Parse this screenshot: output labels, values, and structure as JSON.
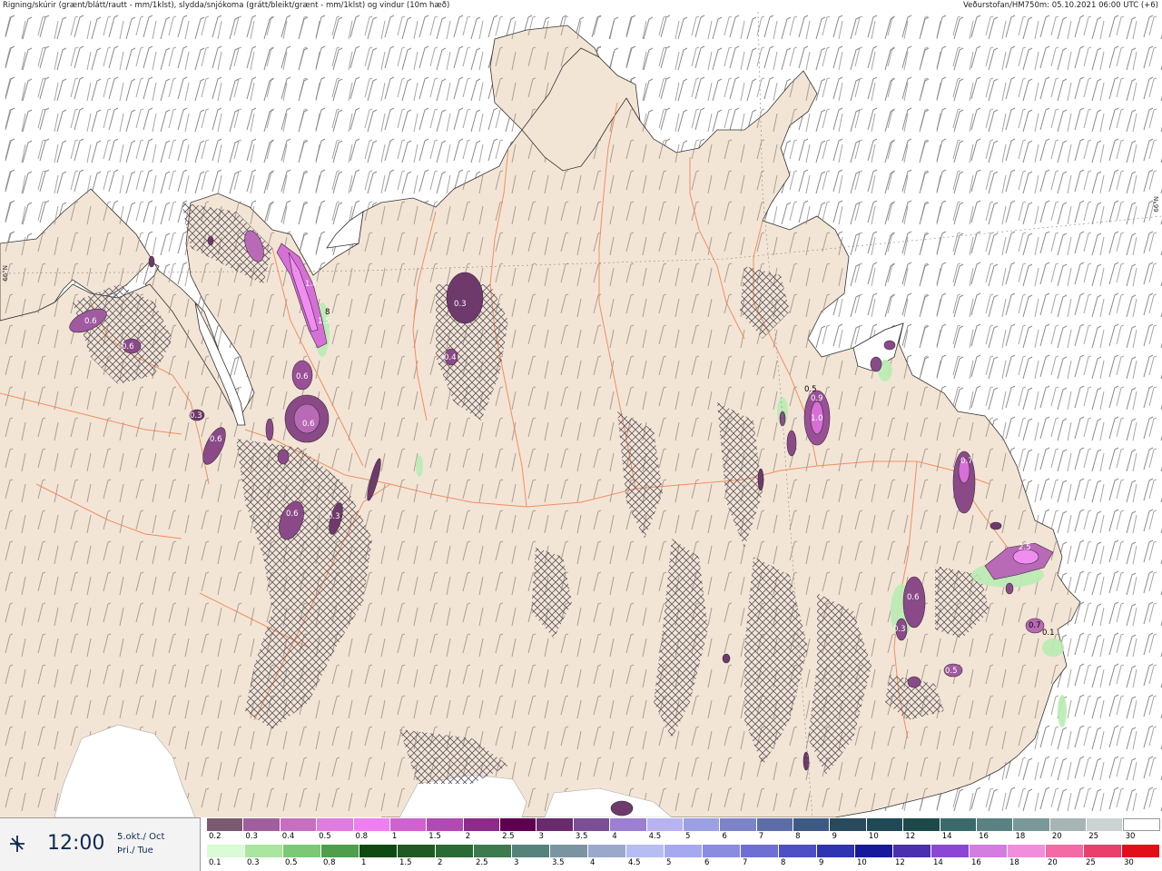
{
  "header": {
    "left": "Rigning/skúrir (grænt/blátt/rautt - mm/1klst), slydda/snjókoma (grátt/bleikt/grænt - mm/1klst) og vindur (10m hæð)",
    "right": "Veðurstofan/HM750m: 05.10.2021 06:00 UTC (+6)"
  },
  "latitude_label": "66°N",
  "time_box": {
    "icon": "wind-icon",
    "time": "12:00",
    "date_line1": "5.okt./ Oct",
    "date_line2": "Þri./ Tue"
  },
  "legend": {
    "top": {
      "labels": [
        "0.2",
        "0.3",
        "0.4",
        "0.5",
        "0.8",
        "1",
        "1.5",
        "2",
        "2.5",
        "3",
        "3.5",
        "4",
        "4.5",
        "5",
        "6",
        "7",
        "8",
        "9",
        "10",
        "12",
        "14",
        "16",
        "18",
        "20",
        "25",
        "30"
      ],
      "colors": [
        "#7a5a70",
        "#a15e9c",
        "#c46fc0",
        "#e17be0",
        "#f07ef0",
        "#cf62cf",
        "#b24ab3",
        "#8d2b8a",
        "#5c004f",
        "#6a2a6e",
        "#7b4f96",
        "#9b7fd0",
        "#b8b2f0",
        "#9aa0e2",
        "#7c84c7",
        "#5d6da8",
        "#3e5a84",
        "#294a5c",
        "#1f4a55",
        "#1c4a49",
        "#3a6a6a",
        "#5a8282",
        "#7a9898",
        "#a7b4b4",
        "#cad2d2",
        "#ffffff"
      ]
    },
    "bottom": {
      "labels": [
        "0.1",
        "0.3",
        "0.5",
        "0.8",
        "1",
        "1.5",
        "2",
        "2.5",
        "3",
        "3.5",
        "4",
        "4.5",
        "5",
        "6",
        "7",
        "8",
        "9",
        "10",
        "12",
        "14",
        "16",
        "18",
        "20",
        "25",
        "30"
      ],
      "colors": [
        "#d9fbd5",
        "#aae69e",
        "#7cc877",
        "#4e9e4c",
        "#0e4a12",
        "#1f5a22",
        "#2a6a34",
        "#3d7a4e",
        "#55827a",
        "#7b94a2",
        "#9aa8cc",
        "#b6bdf2",
        "#a7a9ef",
        "#8a8ce0",
        "#6d70d2",
        "#4d50c4",
        "#3033b2",
        "#16199c",
        "#4a2fae",
        "#8b47d4",
        "#d27de0",
        "#f08edc",
        "#f36aa5",
        "#ea3f6c",
        "#e20e1a"
      ]
    }
  }
}
